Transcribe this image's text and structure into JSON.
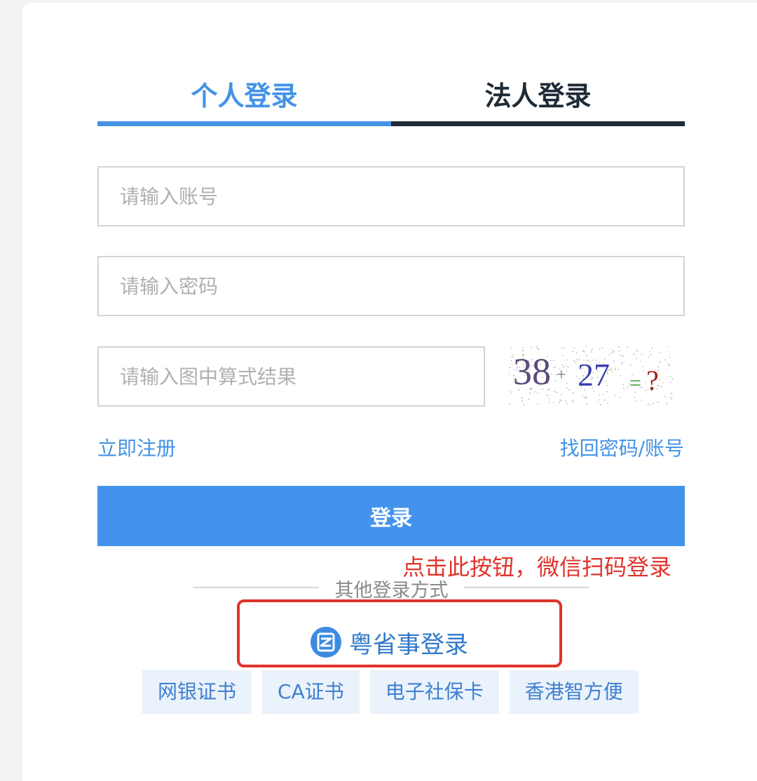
{
  "tabs": {
    "personal": "个人登录",
    "corporate": "法人登录"
  },
  "form": {
    "account_placeholder": "请输入账号",
    "password_placeholder": "请输入密码",
    "captcha_placeholder": "请输入图中算式结果"
  },
  "captcha_image": {
    "text_a": "38",
    "op": "+",
    "text_b": "27",
    "eq": "=",
    "q": "?"
  },
  "links": {
    "register": "立即注册",
    "recover": "找回密码/账号"
  },
  "login_button": "登录",
  "annotation": "点击此按钮，微信扫码登录",
  "other_methods": {
    "divider": "其他登录方式",
    "yueshengshi": "粤省事登录",
    "options": [
      "网银证书",
      "CA证书",
      "电子社保卡",
      "香港智方便"
    ]
  },
  "colors": {
    "accent": "#4393ee",
    "annotation_red": "#e0332b"
  }
}
